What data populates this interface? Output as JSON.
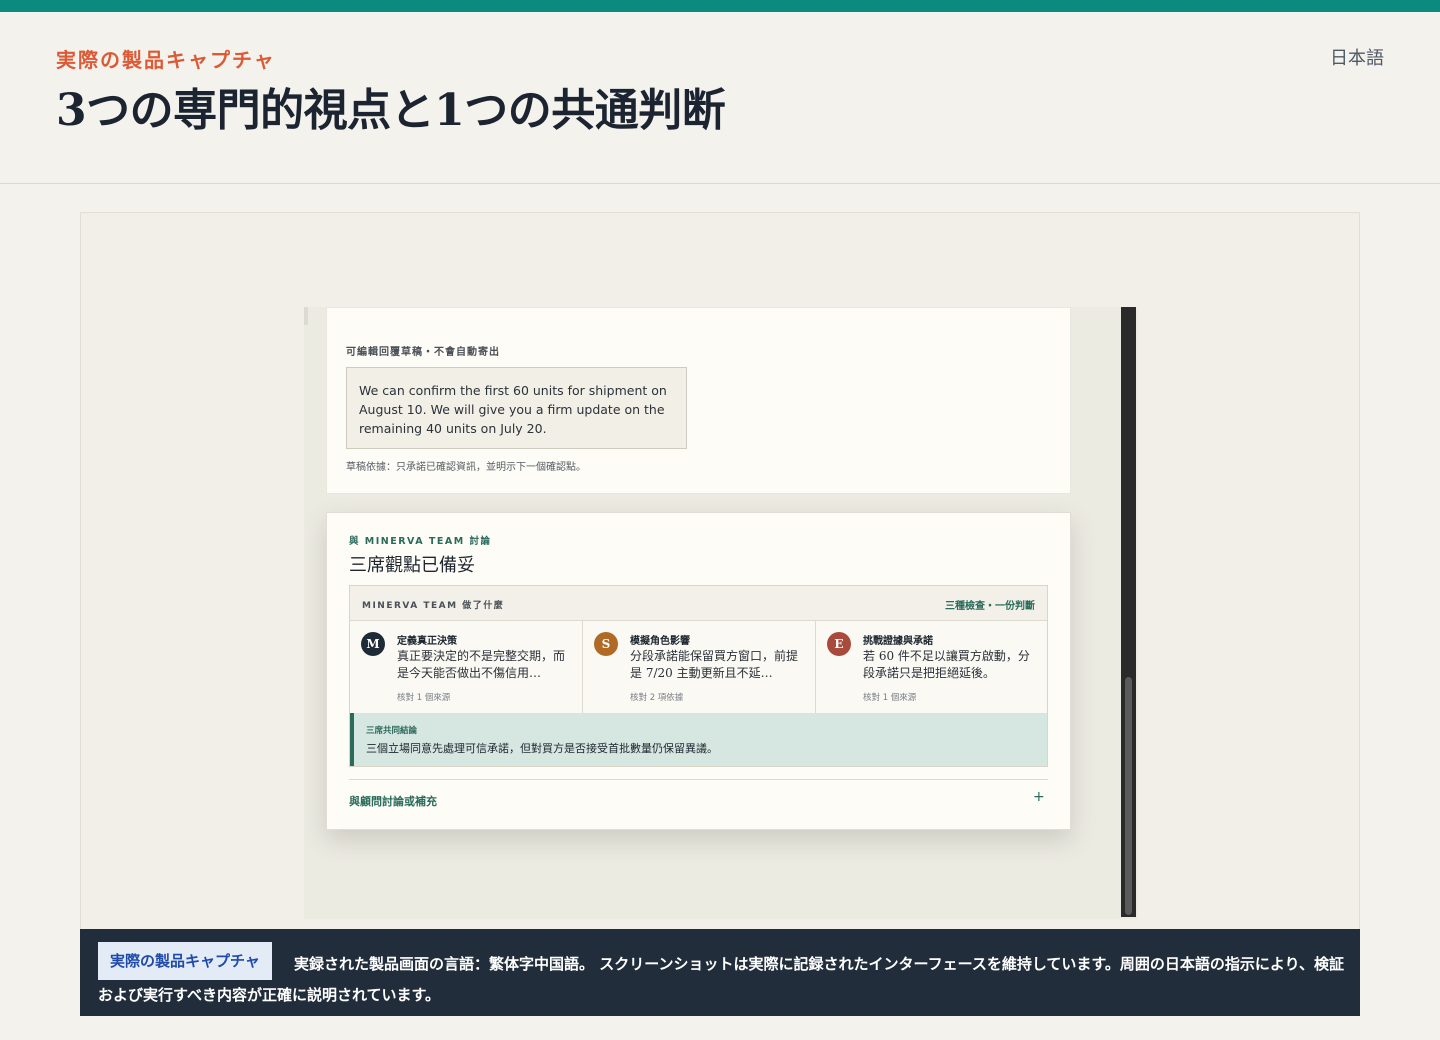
{
  "header": {
    "eyebrow": "実際の製品キャプチャ",
    "title": "3つの専門的視点と1つの共通判断",
    "language": "日本語"
  },
  "screenshot": {
    "draft_card": {
      "title": "可編輯回覆草稿・不會自動寄出",
      "draft_text": "We can confirm the first 60 units for shipment on August 10. We will give you a firm update on the remaining 40 units on July 20.",
      "note": "草稿依據：只承諾已確認資訊，並明示下一個確認點。"
    },
    "team_card": {
      "eyebrow": "與 MINERVA TEAM 討論",
      "title": "三席觀點已備妥",
      "box_header_left": "MINERVA TEAM 做了什麼",
      "box_header_right": "三種檢查・一份判斷",
      "roles": [
        {
          "avatar": "M",
          "color": "#1e2a36",
          "title": "定義真正決策",
          "text": "真正要決定的不是完整交期，而是今天能否做出不傷信用…",
          "meta": "核對 1 個來源"
        },
        {
          "avatar": "S",
          "color": "#b06a26",
          "title": "模擬角色影響",
          "text": "分段承諾能保留買方窗口，前提是 7/20 主動更新且不延…",
          "meta": "核對 2 項依據"
        },
        {
          "avatar": "E",
          "color": "#a84a3c",
          "title": "挑戰證據與承諾",
          "text": "若 60 件不足以讓買方啟動，分段承諾只是把拒絕延後。",
          "meta": "核對 1 個來源"
        }
      ],
      "consensus_label": "三席共同結論",
      "consensus_text": "三個立場同意先處理可信承諾，但對買方是否接受首批數量仍保留異議。",
      "advisor_label": "與顧問討論或補充",
      "plus_icon": "+"
    }
  },
  "caption": {
    "badge": "実際の製品キャプチャ",
    "text": "実録された製品画面の言語：繁体字中国語。 スクリーンショットは実際に記録されたインターフェースを維持しています。周囲の日本語の指示により、検証および実行すべき内容が正確に説明されています。"
  }
}
